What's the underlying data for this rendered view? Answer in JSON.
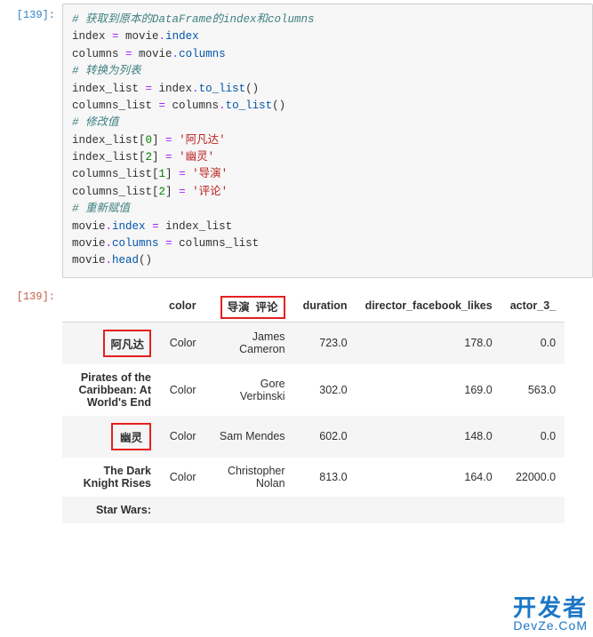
{
  "input_prompt": "[139]:",
  "output_prompt": "[139]:",
  "code": {
    "l01_comment": "# 获取到原本的DataFrame的index和columns",
    "l02a": "index ",
    "op_eq": "=",
    "l02b": " movie",
    "dot": ".",
    "attr_index": "index",
    "l03a": "columns ",
    "l03b": " movie",
    "attr_columns": "columns",
    "l04_comment": "# 转换为列表",
    "l05a": "index_list ",
    "l05b": " index",
    "attr_to_list": "to_list",
    "paren": "()",
    "l06a": "columns_list ",
    "l06b": " columns",
    "l07_comment": "# 修改值",
    "l08a": "index_list[",
    "n0": "0",
    "rb": "] ",
    "s_afd": "'阿凡达'",
    "l09a": "index_list[",
    "n2": "2",
    "s_yl": "'幽灵'",
    "l10a": "columns_list[",
    "n1": "1",
    "s_dy": "'导演'",
    "l11a": "columns_list[",
    "s_pl": "'评论'",
    "l12_comment": "# 重新赋值",
    "l13a": "movie",
    "l13b": " index_list",
    "l14a": "movie",
    "l14b": " columns_list",
    "l15a": "movie",
    "attr_head": "head"
  },
  "table": {
    "columns": {
      "c0": "color",
      "c1": "导演",
      "c2": "评论",
      "c3": "duration",
      "c4": "director_facebook_likes",
      "c5": "actor_3_"
    },
    "rows": [
      {
        "idx": "阿凡达",
        "color": "Color",
        "c1": "James Cameron",
        "c2": "723.0",
        "c3": "178.0",
        "c4": "0.0"
      },
      {
        "idx": "Pirates of the Caribbean: At World's End",
        "color": "Color",
        "c1": "Gore Verbinski",
        "c2": "302.0",
        "c3": "169.0",
        "c4": "563.0"
      },
      {
        "idx": "幽灵",
        "color": "Color",
        "c1": "Sam Mendes",
        "c2": "602.0",
        "c3": "148.0",
        "c4": "0.0"
      },
      {
        "idx": "The Dark Knight Rises",
        "color": "Color",
        "c1": "Christopher Nolan",
        "c2": "813.0",
        "c3": "164.0",
        "c4": "22000.0"
      },
      {
        "idx": "Star Wars:",
        "color": "",
        "c1": "",
        "c2": "",
        "c3": "",
        "c4": ""
      }
    ]
  },
  "watermark": {
    "line1": "开发者",
    "line2": "DevZe.CoM"
  }
}
